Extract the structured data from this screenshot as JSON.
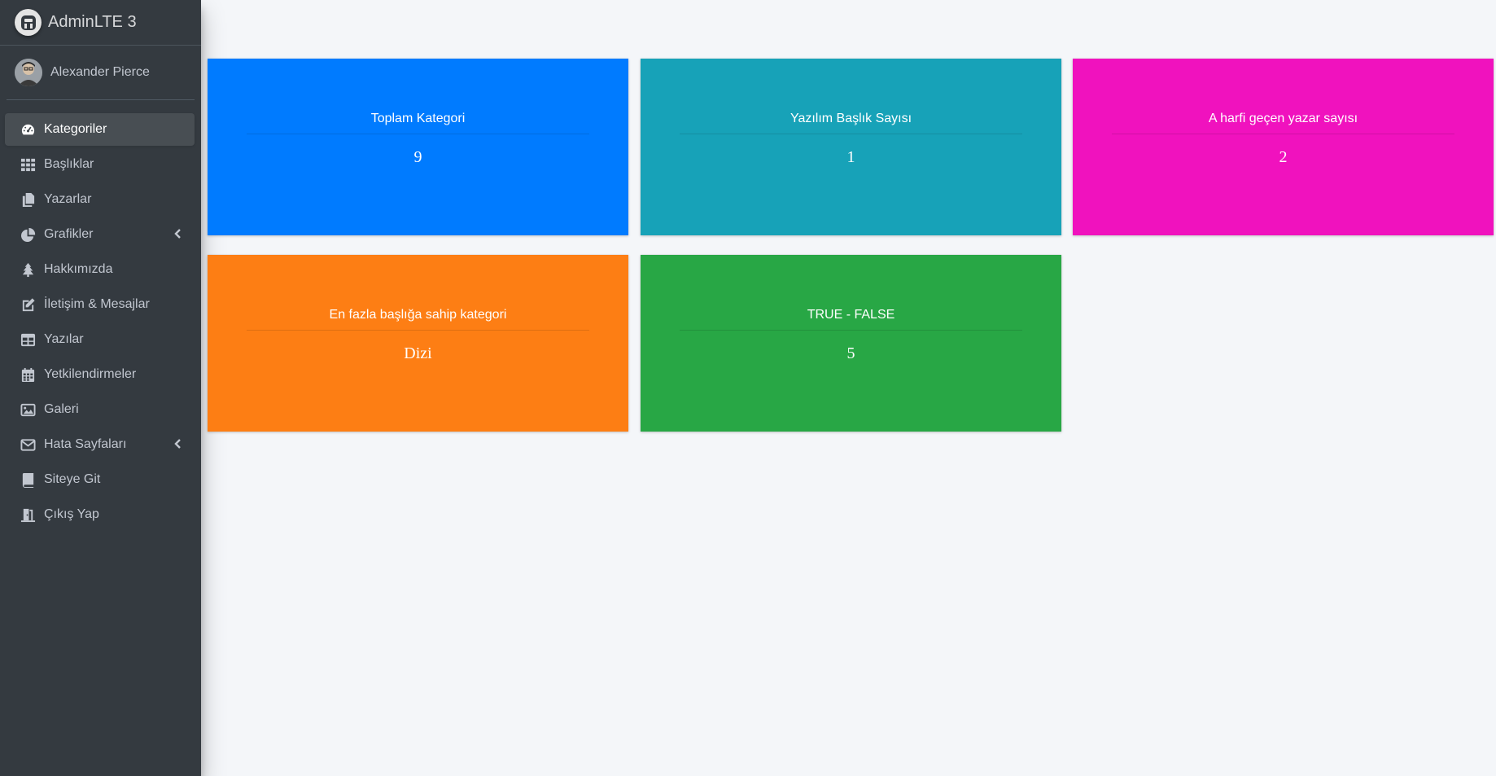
{
  "brand": {
    "title": "AdminLTE 3",
    "logo_icon": "adminlte-logo-icon"
  },
  "user": {
    "name": "Alexander Pierce",
    "avatar_icon": "user-avatar"
  },
  "nav": [
    {
      "label": "Kategoriler",
      "icon": "tachometer-icon",
      "active": true
    },
    {
      "label": "Başlıklar",
      "icon": "th-grid-icon"
    },
    {
      "label": "Yazarlar",
      "icon": "copy-icon"
    },
    {
      "label": "Grafikler",
      "icon": "chart-pie-icon",
      "has_submenu": true
    },
    {
      "label": "Hakkımızda",
      "icon": "tree-icon"
    },
    {
      "label": "İletişim & Mesajlar",
      "icon": "edit-icon"
    },
    {
      "label": "Yazılar",
      "icon": "table-icon"
    },
    {
      "label": "Yetkilendirmeler",
      "icon": "calendar-icon"
    },
    {
      "label": "Galeri",
      "icon": "image-icon"
    },
    {
      "label": "Hata Sayfaları",
      "icon": "envelope-icon",
      "has_submenu": true
    },
    {
      "label": "Siteye Git",
      "icon": "book-icon"
    },
    {
      "label": "Çıkış Yap",
      "icon": "door-icon"
    }
  ],
  "cards": [
    {
      "title": "Toplam Kategori",
      "value": "9",
      "color": "#007bff"
    },
    {
      "title": "Yazılım Başlık Sayısı",
      "value": "1",
      "color": "#17a2b8"
    },
    {
      "title": "A harfi geçen yazar sayısı",
      "value": "2",
      "color": "#f012be"
    },
    {
      "title": "En fazla başlığa sahip kategori",
      "value": "Dizi",
      "color": "#fd7e14"
    },
    {
      "title": "TRUE - FALSE",
      "value": "5",
      "color": "#28a745"
    }
  ]
}
